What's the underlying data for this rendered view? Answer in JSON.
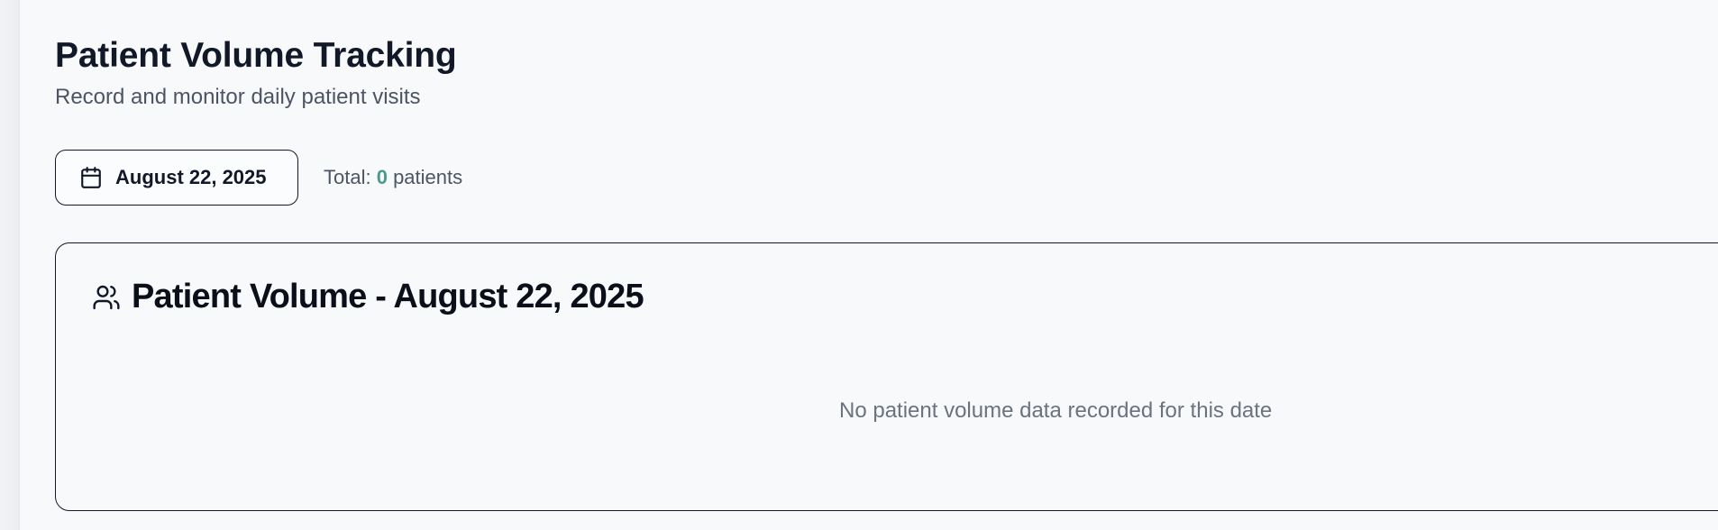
{
  "header": {
    "title": "Patient Volume Tracking",
    "subtitle": "Record and monitor daily patient visits"
  },
  "toolbar": {
    "date_label": "August 22, 2025",
    "date_icon": "calendar-icon",
    "total_prefix": "Total: ",
    "total_count": "0",
    "total_suffix": " patients"
  },
  "card": {
    "icon": "users-icon",
    "title": "Patient Volume - August 22, 2025",
    "empty_message": "No patient volume data recorded for this date"
  },
  "colors": {
    "background": "#f8f9fb",
    "accent": "#4a9b8e",
    "text_primary": "#111827",
    "text_muted": "#6b7280"
  }
}
